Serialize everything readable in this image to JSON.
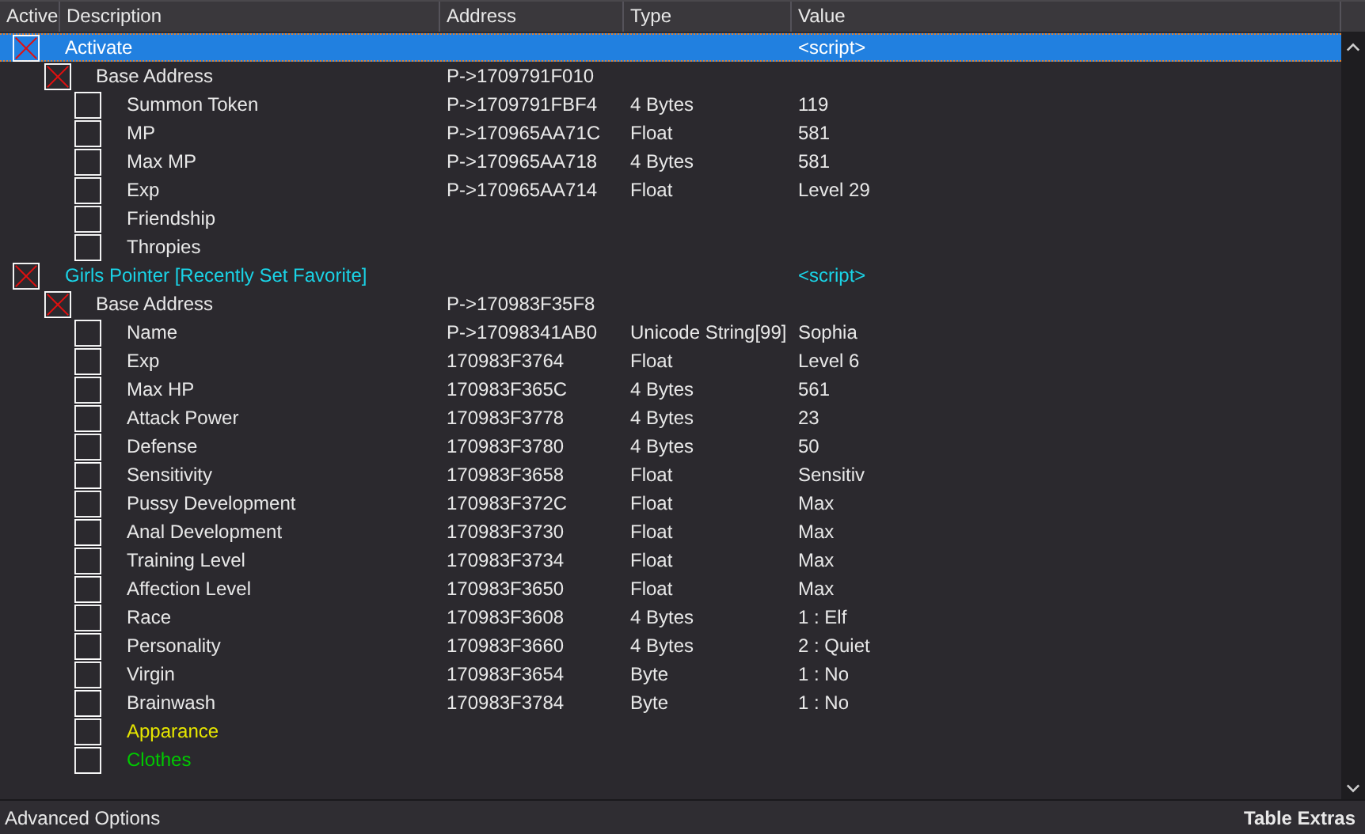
{
  "columns": [
    "Active",
    "Description",
    "Address",
    "Type",
    "Value"
  ],
  "rows": [
    {
      "kind": "crossed",
      "selected": true,
      "description": "Activate",
      "value": "<script>",
      "color": "#ffffff",
      "children": [
        {
          "kind": "crossed",
          "selected": false,
          "description": "Base Address",
          "address": "P->1709791F010",
          "children": [
            {
              "kind": "plain",
              "selected": false,
              "description": "Summon Token",
              "address": "P->1709791FBF4",
              "type": "4 Bytes",
              "value": "119"
            },
            {
              "kind": "plain",
              "selected": false,
              "description": "MP",
              "address": "P->170965AA71C",
              "type": "Float",
              "value": "581"
            },
            {
              "kind": "plain",
              "selected": false,
              "description": "Max MP",
              "address": "P->170965AA718",
              "type": "4 Bytes",
              "value": "581"
            },
            {
              "kind": "plain",
              "selected": false,
              "description": "Exp",
              "address": "P->170965AA714",
              "type": "Float",
              "value": "Level 29"
            },
            {
              "kind": "plain",
              "selected": false,
              "description": "Friendship"
            },
            {
              "kind": "plain",
              "selected": false,
              "description": "Thropies"
            }
          ]
        }
      ]
    },
    {
      "kind": "crossed",
      "selected": false,
      "description": "Girls Pointer [Recently Set Favorite]",
      "value": "<script>",
      "color": "#1ad3e6",
      "children": [
        {
          "kind": "crossed",
          "selected": false,
          "description": "Base Address",
          "address": "P->170983F35F8",
          "children": [
            {
              "kind": "plain",
              "selected": false,
              "description": "Name",
              "address": "P->17098341AB0",
              "type": "Unicode String[99]",
              "value": "Sophia"
            },
            {
              "kind": "plain",
              "selected": false,
              "description": "Exp",
              "address": "170983F3764",
              "type": "Float",
              "value": "Level 6"
            },
            {
              "kind": "plain",
              "selected": false,
              "description": "Max HP",
              "address": "170983F365C",
              "type": "4 Bytes",
              "value": "561"
            },
            {
              "kind": "plain",
              "selected": false,
              "description": "Attack Power",
              "address": "170983F3778",
              "type": "4 Bytes",
              "value": "23"
            },
            {
              "kind": "plain",
              "selected": false,
              "description": "Defense",
              "address": "170983F3780",
              "type": "4 Bytes",
              "value": "50"
            },
            {
              "kind": "plain",
              "selected": false,
              "description": "Sensitivity",
              "address": "170983F3658",
              "type": "Float",
              "value": "Sensitiv"
            },
            {
              "kind": "plain",
              "selected": false,
              "description": "Pussy Development",
              "address": "170983F372C",
              "type": "Float",
              "value": "Max"
            },
            {
              "kind": "plain",
              "selected": false,
              "description": "Anal Development",
              "address": "170983F3730",
              "type": "Float",
              "value": "Max"
            },
            {
              "kind": "plain",
              "selected": false,
              "description": "Training Level",
              "address": "170983F3734",
              "type": "Float",
              "value": "Max"
            },
            {
              "kind": "plain",
              "selected": false,
              "description": "Affection Level",
              "address": "170983F3650",
              "type": "Float",
              "value": "Max"
            },
            {
              "kind": "plain",
              "selected": false,
              "description": "Race",
              "address": "170983F3608",
              "type": "4 Bytes",
              "value": "1 : Elf"
            },
            {
              "kind": "plain",
              "selected": false,
              "description": "Personality",
              "address": "170983F3660",
              "type": "4 Bytes",
              "value": "2 : Quiet"
            },
            {
              "kind": "plain",
              "selected": false,
              "description": "Virgin",
              "address": "170983F3654",
              "type": "Byte",
              "value": "1 : No"
            },
            {
              "kind": "plain",
              "selected": false,
              "description": "Brainwash",
              "address": "170983F3784",
              "type": "Byte",
              "value": "1 : No"
            },
            {
              "kind": "plain",
              "selected": false,
              "description": "Apparance",
              "color": "#e6e600"
            },
            {
              "kind": "plain",
              "selected": false,
              "description": "Clothes",
              "color": "#00c800"
            }
          ]
        }
      ]
    }
  ],
  "footer": {
    "left": "Advanced Options",
    "right": "Table Extras"
  }
}
